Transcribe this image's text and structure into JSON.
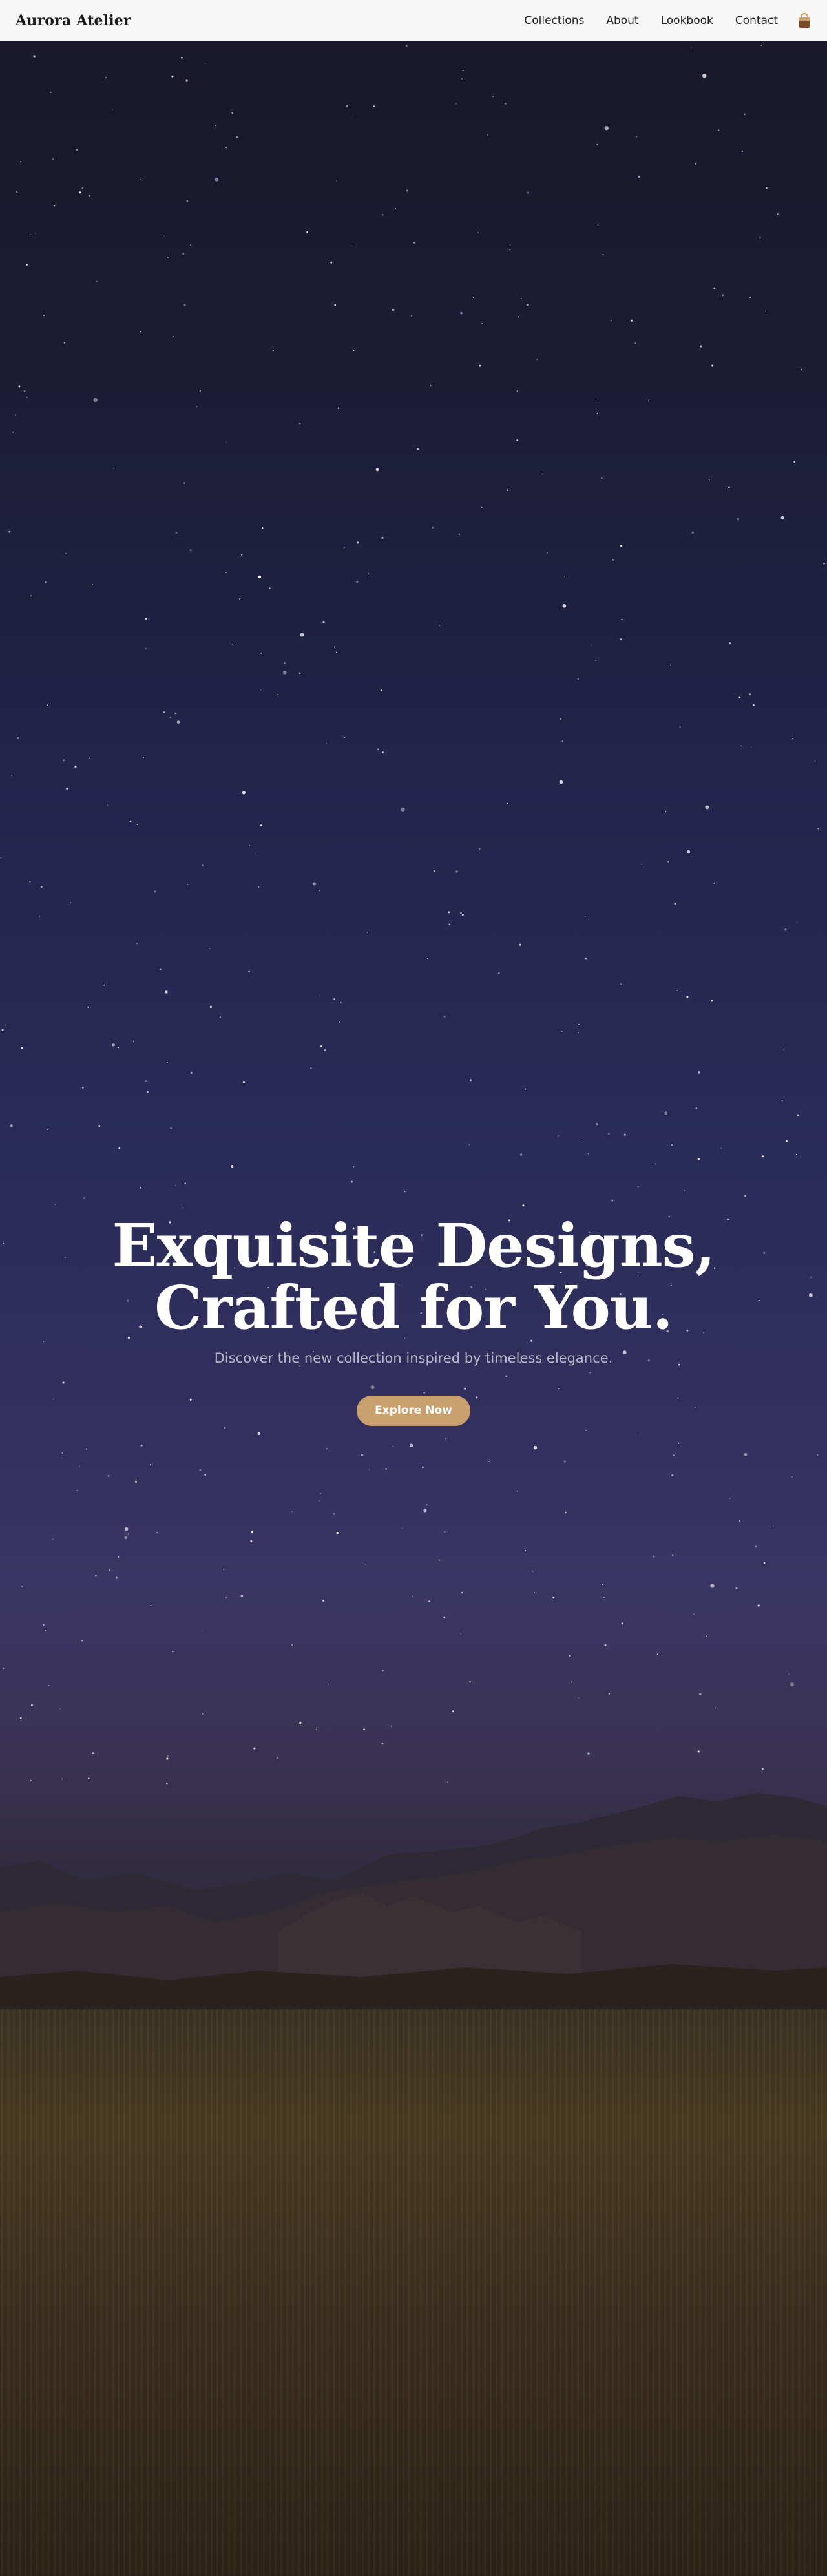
{
  "nav": {
    "brand": "Aurora Atelier",
    "links": [
      "Collections",
      "About",
      "Lookbook",
      "Contact"
    ],
    "cart_icon": "shopping-bag-icon"
  },
  "hero": {
    "headline_line1": "Exquisite Designs,",
    "headline_line2": "Crafted for You.",
    "subtitle": "Discover the new collection inspired by timeless elegance.",
    "cta_label": "Explore Now",
    "background_image": "starry night sky over mountains and meadow"
  },
  "colors": {
    "nav_background": "#f7f7f7",
    "cta_background": "#c9a06d",
    "headline": "#ffffff",
    "subtitle": "#b9b6c8"
  }
}
